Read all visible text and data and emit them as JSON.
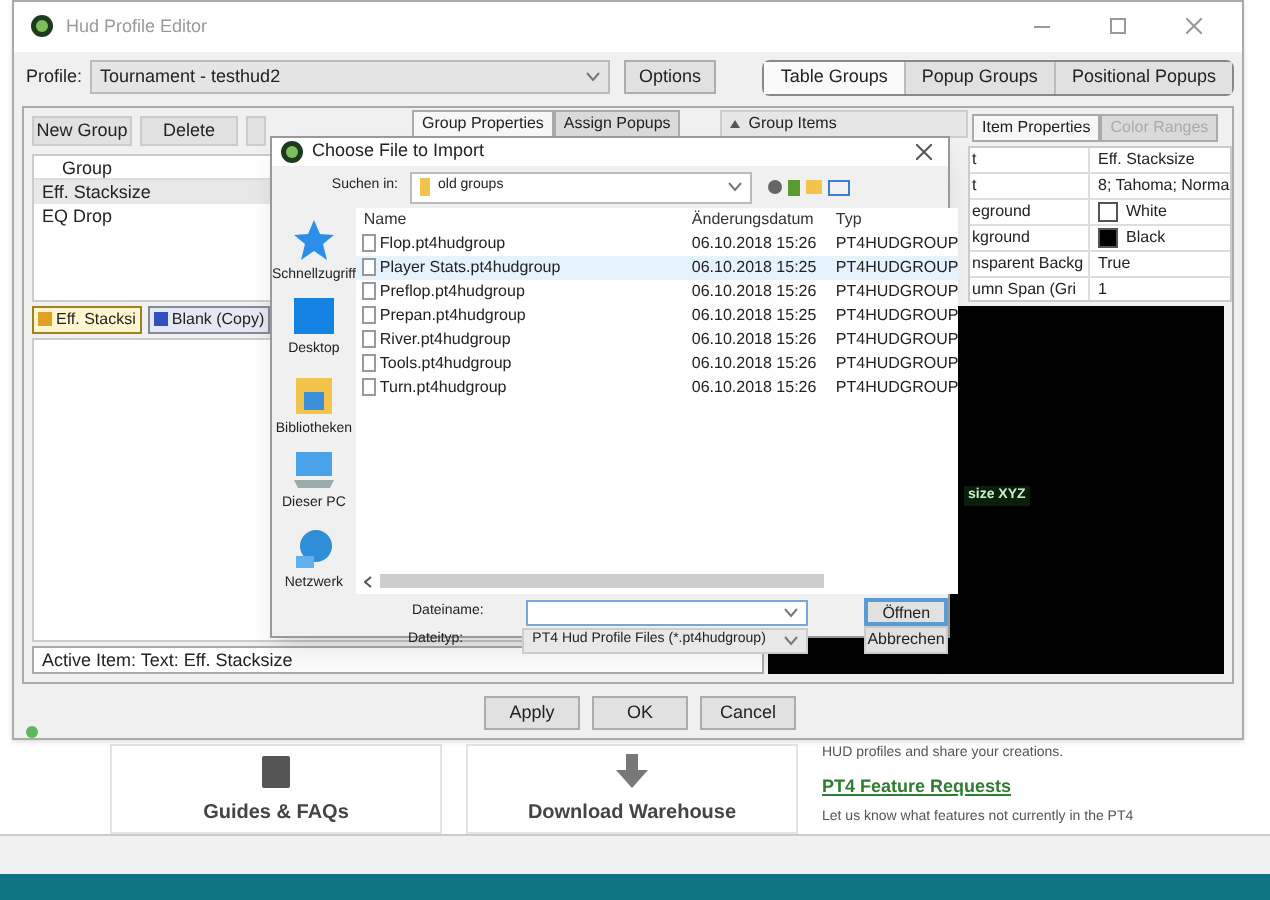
{
  "background_page": {
    "text_1": "HUD profiles and share your creations.",
    "link": "PT4 Feature Requests",
    "text_2": "Let us know what features not currently in the PT4",
    "cards": [
      {
        "title": "Guides & FAQs",
        "kind": "book"
      },
      {
        "title": "Download Warehouse",
        "kind": "download"
      }
    ]
  },
  "window": {
    "title": "Hud Profile Editor"
  },
  "profile": {
    "label": "Profile:",
    "value": "Tournament - testhud2",
    "options_button": "Options"
  },
  "view_tabs": [
    {
      "label": "Table Groups",
      "selected": true
    },
    {
      "label": "Popup Groups",
      "selected": false
    },
    {
      "label": "Positional Popups",
      "selected": false
    }
  ],
  "group_toolbar": [
    "New Group",
    "Delete"
  ],
  "group_list": {
    "header": "Group",
    "rows": [
      {
        "name": "Eff. Stacksize",
        "selected": true
      },
      {
        "name": "EQ Drop",
        "selected": false
      }
    ]
  },
  "item_tabs": [
    {
      "label": "Eff. Stacksi",
      "selected": true
    },
    {
      "label": "Blank (Copy)",
      "selected": false
    }
  ],
  "status": "Active Item: Text: Eff. Stacksize",
  "middle_tabs": [
    {
      "label": "Group Properties",
      "selected": true
    },
    {
      "label": "Assign Popups",
      "selected": false
    }
  ],
  "group_items_label": "Group Items",
  "property_tabs": [
    {
      "label": "Item Properties",
      "selected": true,
      "disabled": false
    },
    {
      "label": "Color Ranges",
      "selected": false,
      "disabled": true
    }
  ],
  "properties": [
    {
      "name": "t",
      "value": "Eff. Stacksize"
    },
    {
      "name": "t",
      "value": "8; Tahoma; Norma"
    },
    {
      "name": "eground",
      "value": "White",
      "color": "#ffffff"
    },
    {
      "name": "kground",
      "value": "Black",
      "color": "#000000"
    },
    {
      "name": "nsparent Backg",
      "value": "True"
    },
    {
      "name": "umn Span (Gri",
      "value": "1"
    }
  ],
  "preview": {
    "text": "size XYZ"
  },
  "buttons": [
    "Apply",
    "OK",
    "Cancel"
  ],
  "dialog": {
    "title": "Choose File to Import",
    "look_in_label": "Suchen in:",
    "folder": "old groups",
    "places": [
      {
        "label": "Schnellzugriff",
        "kind": "star"
      },
      {
        "label": "Desktop",
        "kind": "desktop"
      },
      {
        "label": "Bibliotheken",
        "kind": "library"
      },
      {
        "label": "Dieser PC",
        "kind": "pc"
      },
      {
        "label": "Netzwerk",
        "kind": "network"
      }
    ],
    "columns": [
      "Name",
      "Änderungsdatum",
      "Typ"
    ],
    "files": [
      {
        "name": "Flop.pt4hudgroup",
        "date": "06.10.2018 15:26",
        "type": "PT4HUDGROUP",
        "selected": false
      },
      {
        "name": "Player Stats.pt4hudgroup",
        "date": "06.10.2018 15:25",
        "type": "PT4HUDGROUP",
        "selected": true
      },
      {
        "name": "Preflop.pt4hudgroup",
        "date": "06.10.2018 15:26",
        "type": "PT4HUDGROUP",
        "selected": false
      },
      {
        "name": "Prepan.pt4hudgroup",
        "date": "06.10.2018 15:25",
        "type": "PT4HUDGROUP",
        "selected": false
      },
      {
        "name": "River.pt4hudgroup",
        "date": "06.10.2018 15:26",
        "type": "PT4HUDGROUP",
        "selected": false
      },
      {
        "name": "Tools.pt4hudgroup",
        "date": "06.10.2018 15:26",
        "type": "PT4HUDGROUP",
        "selected": false
      },
      {
        "name": "Turn.pt4hudgroup",
        "date": "06.10.2018 15:26",
        "type": "PT4HUDGROUP",
        "selected": false
      }
    ],
    "filename_label": "Dateiname:",
    "filetype_label": "Dateityp:",
    "filetype": "PT4 Hud Profile Files (*.pt4hudgroup)",
    "open_button": "Öffnen",
    "cancel_button": "Abbrechen"
  }
}
